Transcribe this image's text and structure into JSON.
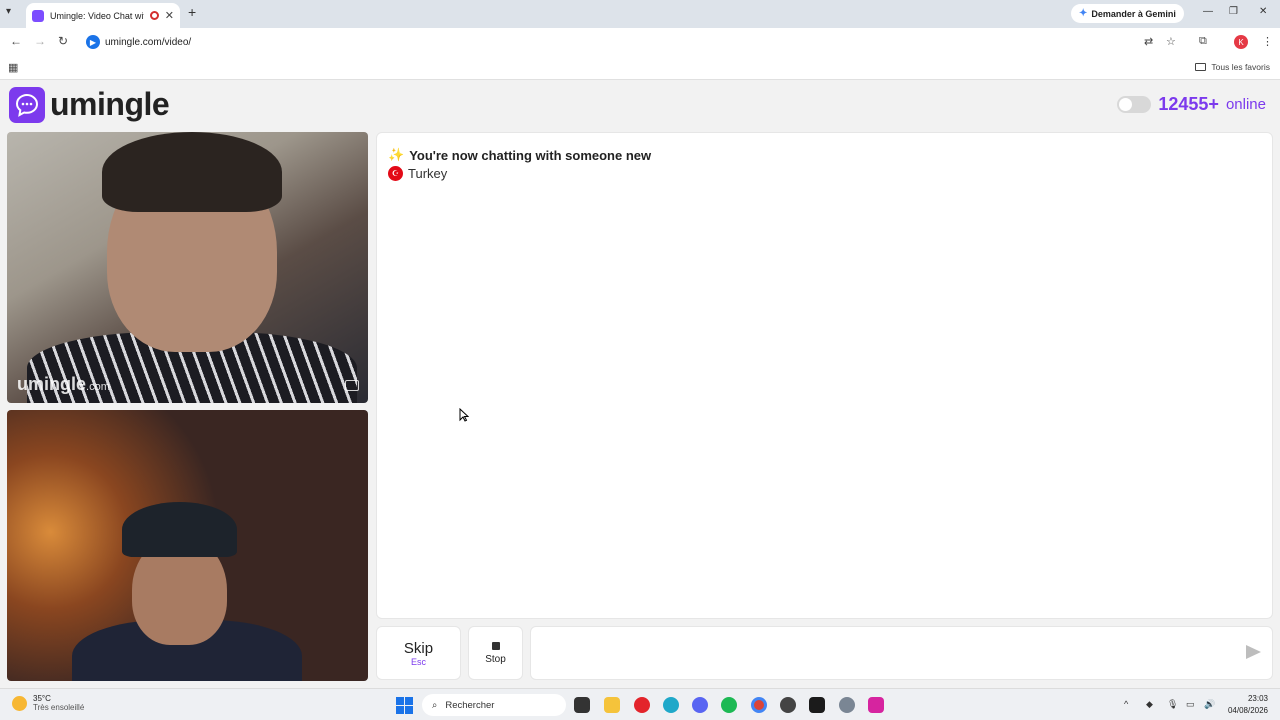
{
  "browser": {
    "tab_title": "Umingle: Video Chat with S",
    "new_tab": "+",
    "gemini_label": "Demander à Gemini",
    "url": "umingle.com/video/",
    "bookmarks_label": "Tous les favoris",
    "profile_initial": "K"
  },
  "page": {
    "logo_text": "umingle",
    "online_count": "12455+",
    "online_label": "online",
    "remote_watermark": "umingle",
    "remote_watermark_suffix": ".com",
    "chat": {
      "message": "You're now chatting with someone new",
      "country": "Turkey"
    },
    "controls": {
      "skip_label": "Skip",
      "skip_hint": "Esc",
      "stop_label": "Stop",
      "message_placeholder": ""
    },
    "colors": {
      "brand": "#7c3aed"
    }
  },
  "taskbar": {
    "temperature": "35°C",
    "weather": "Très ensoleillé",
    "search_label": "Rechercher",
    "time": "23:03",
    "date": "04/08/2026"
  }
}
